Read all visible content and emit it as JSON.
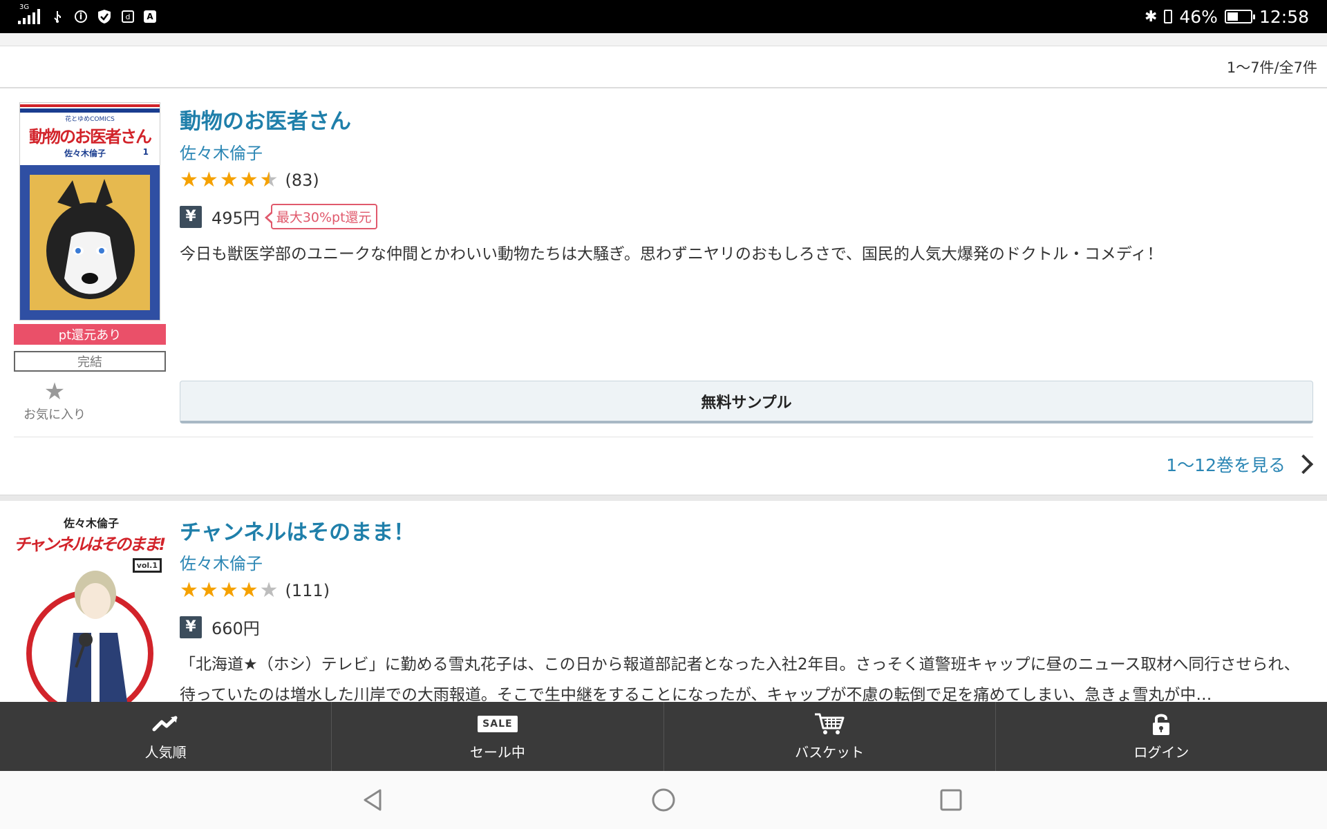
{
  "status_bar": {
    "network": "3G",
    "battery": "46%",
    "battery_level": 0.46,
    "time": "12:58"
  },
  "result_count": "1〜7件/全7件",
  "items": [
    {
      "title": "動物のお医者さん",
      "author": "佐々木倫子",
      "rating": 4.5,
      "rating_count": "(83)",
      "price": "495円",
      "point_badge": "最大30%pt還元",
      "description": "今日も獣医学部のユニークな仲間とかわいい動物たちは大騒ぎ。思わずニヤリのおもしろさで、国民的人気大爆発のドクトル・コメディ！",
      "tag_point": "pt還元あり",
      "tag_status": "完結",
      "favorite_label": "お気に入り",
      "sample_button": "無料サンプル",
      "see_volumes": "1〜12巻を見る",
      "cover": {
        "label_top": "花とゆめCOMICS",
        "label_title": "動物のお医者さん",
        "label_author": "佐々木倫子",
        "label_vol": "1"
      }
    },
    {
      "title": "チャンネルはそのまま！",
      "author": "佐々木倫子",
      "rating": 4,
      "rating_count": "(111)",
      "price": "660円",
      "description": "「北海道★（ホシ）テレビ」に勤める雪丸花子は、この日から報道部記者となった入社2年目。さっそく道警班キャップに昼のニュース取材へ同行させられ、待っていたのは増水した川岸での大雨報道。そこで生中継をすることになったが、キャップが不慮の転倒で足を痛めてしまい、急きょ雪丸が中…",
      "cover": {
        "label_author": "佐々木倫子",
        "label_title": "チャンネルはそのまま!",
        "label_vol": "vol.1"
      }
    }
  ],
  "bottom_nav": [
    {
      "label": "人気順",
      "icon": "trending-icon"
    },
    {
      "label": "セール中",
      "icon": "sale-icon",
      "icon_text": "SALE"
    },
    {
      "label": "バスケット",
      "icon": "cart-icon"
    },
    {
      "label": "ログイン",
      "icon": "unlock-icon"
    }
  ],
  "colors": {
    "title": "#1f7faa",
    "link": "#2b86b4",
    "star": "#f5a100",
    "pt_tag": "#ea5069",
    "nav_bg": "#3a3a3a"
  }
}
